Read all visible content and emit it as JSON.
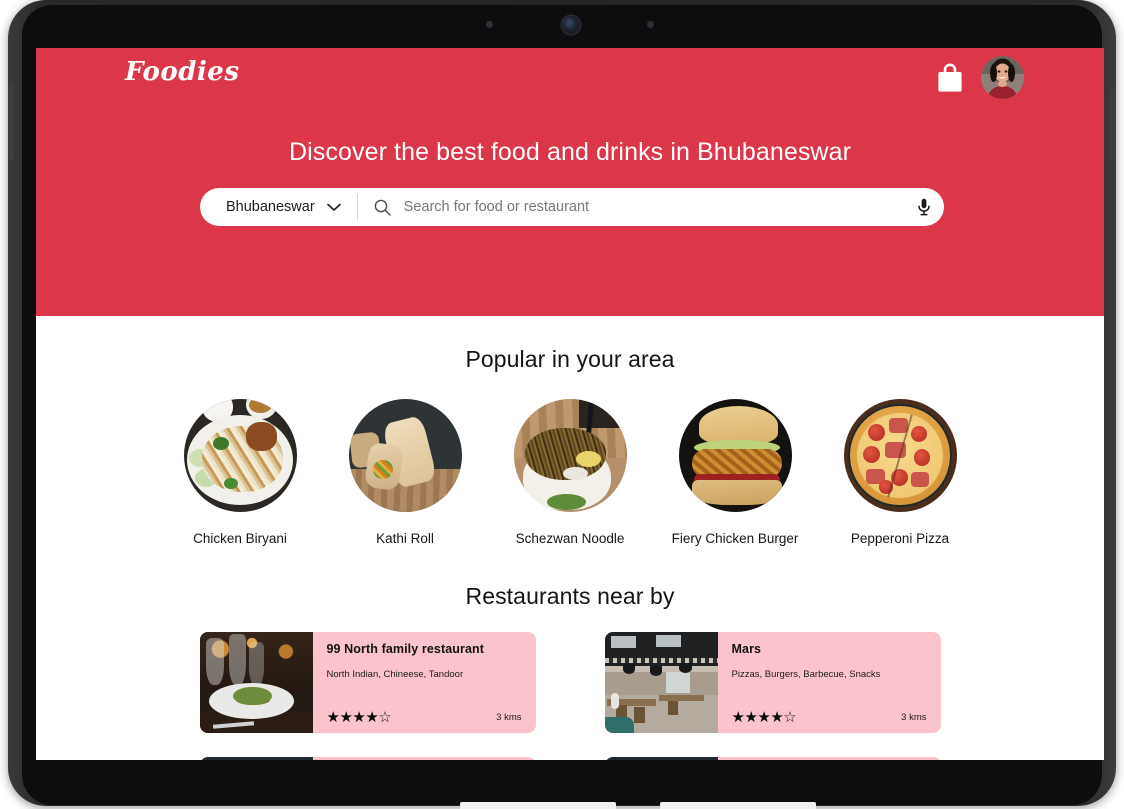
{
  "app": {
    "brand": "Foodies",
    "accent_color": "#dc3649",
    "card_color": "#fbc3cb"
  },
  "header": {
    "logo_text": "Foodies",
    "cart_icon": "shopping-bag-icon",
    "avatar_icon": "user-avatar"
  },
  "hero": {
    "title": "Discover the best food and drinks in Bhubaneswar",
    "city": "Bhubaneswar",
    "city_chevron": "chevron-down-icon",
    "search_placeholder": "Search for food or restaurant",
    "search_value": "",
    "search_icon": "search-icon",
    "mic_icon": "microphone-icon"
  },
  "popular": {
    "title": "Popular in your area",
    "items": [
      {
        "label": "Chicken Biryani"
      },
      {
        "label": "Kathi Roll"
      },
      {
        "label": "Schezwan Noodle"
      },
      {
        "label": "Fiery Chicken Burger"
      },
      {
        "label": "Pepperoni Pizza"
      }
    ]
  },
  "restaurants": {
    "title": "Restaurants near by",
    "cards": [
      {
        "name": "99 North family restaurant",
        "cuisine": "North Indian, Chineese,  Tandoor",
        "stars": "★★★★☆",
        "distance": "3 kms"
      },
      {
        "name": "Mars",
        "cuisine": "Pizzas, Burgers, Barbecue, Snacks",
        "stars": "★★★★☆",
        "distance": "3 kms"
      }
    ]
  },
  "device": {
    "camera_icon": "front-camera-lens",
    "sensor_left_icon": "sensor-dot-icon",
    "sensor_right_icon": "sensor-dot-icon",
    "volume_button": "volume-button",
    "power_button": "power-button"
  }
}
